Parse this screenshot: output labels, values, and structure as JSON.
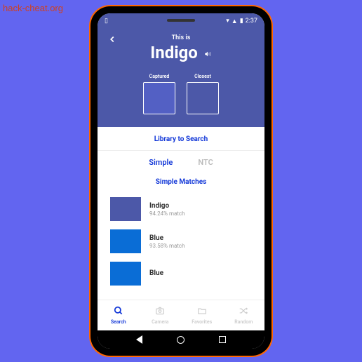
{
  "watermark": "hack-cheat.org",
  "status": {
    "time": "2:37",
    "battery_icon": "▮"
  },
  "header": {
    "this_is": "This is",
    "color_name": "Indigo",
    "captured_label": "Captured",
    "closest_label": "Closest",
    "captured_color": "#5360c4",
    "closest_color": "#4c58a8"
  },
  "library": {
    "title": "Library to Search",
    "tabs": [
      "Simple",
      "NTC"
    ],
    "active_tab": 0
  },
  "matches": {
    "title": "Simple Matches",
    "items": [
      {
        "name": "Indigo",
        "pct": "94.24% match",
        "color": "#4c58a8"
      },
      {
        "name": "Blue",
        "pct": "93.58% match",
        "color": "#0a6dd6"
      },
      {
        "name": "Blue",
        "pct": "",
        "color": "#0a6dd6"
      }
    ]
  },
  "nav": {
    "items": [
      {
        "label": "Search",
        "icon": "search"
      },
      {
        "label": "Camera",
        "icon": "camera"
      },
      {
        "label": "Favorites",
        "icon": "folder"
      },
      {
        "label": "Random",
        "icon": "shuffle"
      }
    ],
    "active": 0
  }
}
